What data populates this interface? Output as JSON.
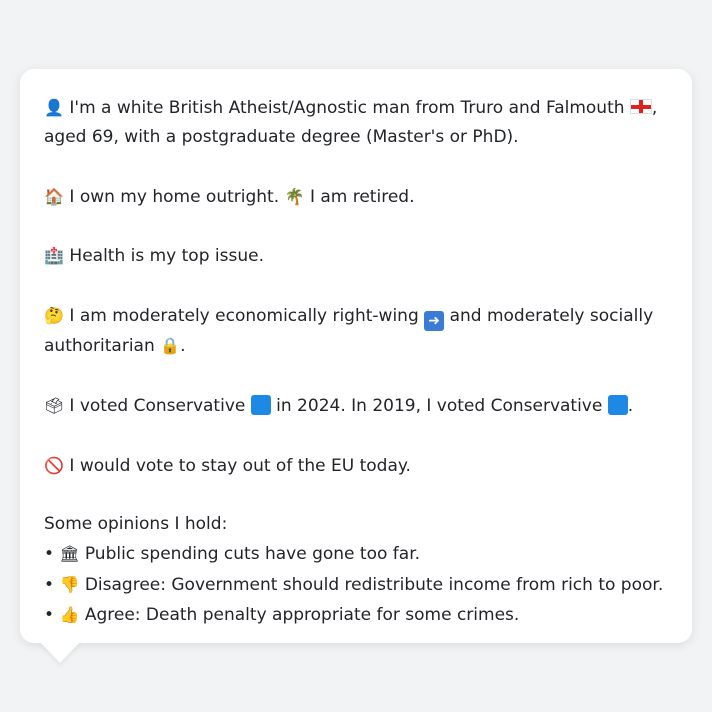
{
  "colors": {
    "background": "#f1f3f5",
    "card": "#ffffff",
    "text": "#222429",
    "party_square": "#1e88e5"
  },
  "profile": {
    "p1": {
      "icon": "person-silhouette-icon",
      "line1": "I'm a white British Atheist/Agnostic man from Truro and Falmouth",
      "flag_icon": "england-flag-icon",
      "line1_end": ",",
      "line2": "aged 69, with a postgraduate degree (Master's or PhD)."
    },
    "p2": {
      "house_icon": "house-icon",
      "home": "I own my home outright.",
      "palm_icon": "palm-tree-icon",
      "retired": "I am retired."
    },
    "p3": {
      "hospital_icon": "hospital-icon",
      "text": "Health is my top issue."
    },
    "p4": {
      "thinking_icon": "thinking-face-icon",
      "line1a": "I am moderately economically right-wing",
      "arrow_icon": "right-arrow-icon",
      "line1b": "and moderately socially",
      "line2": "authoritarian",
      "lock_icon": "lock-icon",
      "line2_end": "."
    },
    "p5": {
      "ballot_icon": "ballot-box-icon",
      "part1": "I voted Conservative",
      "part2": "in 2024. In 2019, I voted Conservative",
      "part3": "."
    },
    "p6": {
      "no_entry_icon": "no-entry-icon",
      "text": "I would vote to stay out of the EU today."
    },
    "opinions": {
      "heading": "Some opinions I hold:",
      "bullet": "•",
      "items": [
        {
          "icon": "classical-building-icon",
          "text": "Public spending cuts have gone too far."
        },
        {
          "icon": "thumbs-down-icon",
          "text": "Disagree: Government should redistribute income from rich to poor."
        },
        {
          "icon": "thumbs-up-icon",
          "text": "Agree: Death penalty appropriate for some crimes."
        }
      ]
    }
  }
}
